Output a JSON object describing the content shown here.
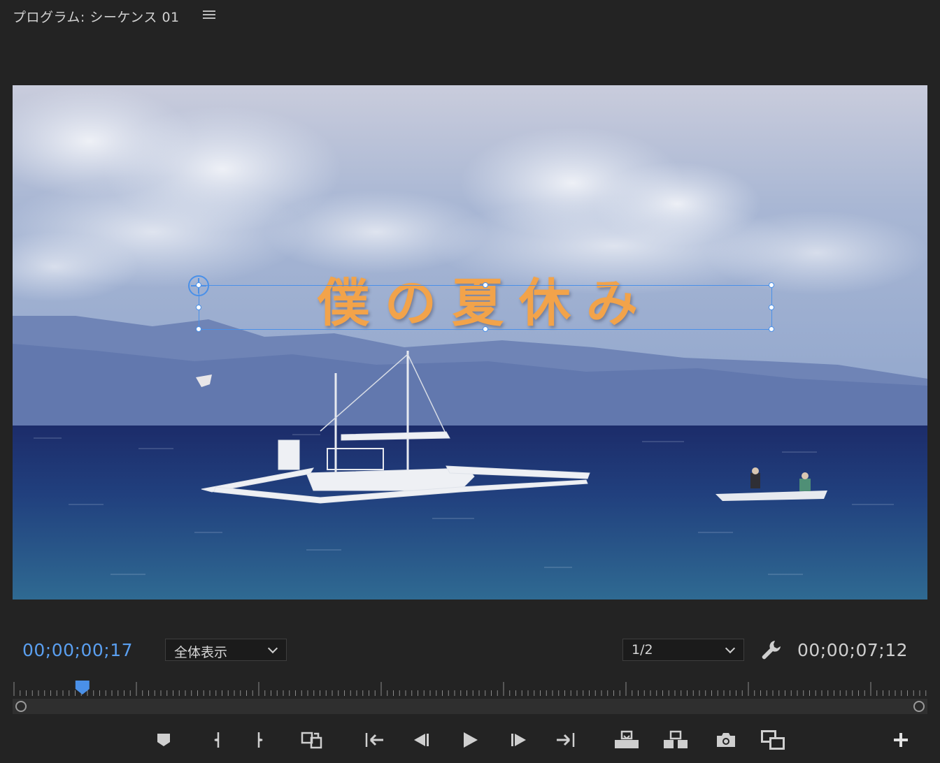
{
  "panel": {
    "title": "プログラム: シーケンス 01",
    "menu_icon": "hamburger-menu-icon"
  },
  "overlay": {
    "title_text": "僕の夏休み",
    "title_color": "#f2a34a",
    "selection_color": "#4a90e8"
  },
  "bottom_bar": {
    "current_timecode": "00;00;00;17",
    "current_timecode_color": "#5a9ff0",
    "fit_dropdown": "全体表示",
    "resolution_dropdown": "1/2",
    "settings_icon": "wrench-icon",
    "duration_timecode": "00;00;07;12"
  },
  "playhead": {
    "position_fraction": 0.075
  },
  "transport": [
    {
      "name": "add-marker-button",
      "icon": "marker-icon"
    },
    {
      "name": "mark-in-button",
      "icon": "mark-in-icon"
    },
    {
      "name": "mark-out-button",
      "icon": "mark-out-icon"
    },
    {
      "name": "loop-button",
      "icon": "loop-icon"
    },
    {
      "name": "go-to-in-button",
      "icon": "go-to-in-icon"
    },
    {
      "name": "step-back-button",
      "icon": "step-back-icon"
    },
    {
      "name": "play-button",
      "icon": "play-icon"
    },
    {
      "name": "step-forward-button",
      "icon": "step-forward-icon"
    },
    {
      "name": "go-to-out-button",
      "icon": "go-to-out-icon"
    },
    {
      "name": "lift-button",
      "icon": "lift-icon"
    },
    {
      "name": "extract-button",
      "icon": "extract-icon"
    },
    {
      "name": "export-frame-button",
      "icon": "camera-icon"
    },
    {
      "name": "compare-view-button",
      "icon": "film-compare-icon"
    },
    {
      "name": "add-button",
      "icon": "plus-icon"
    }
  ]
}
